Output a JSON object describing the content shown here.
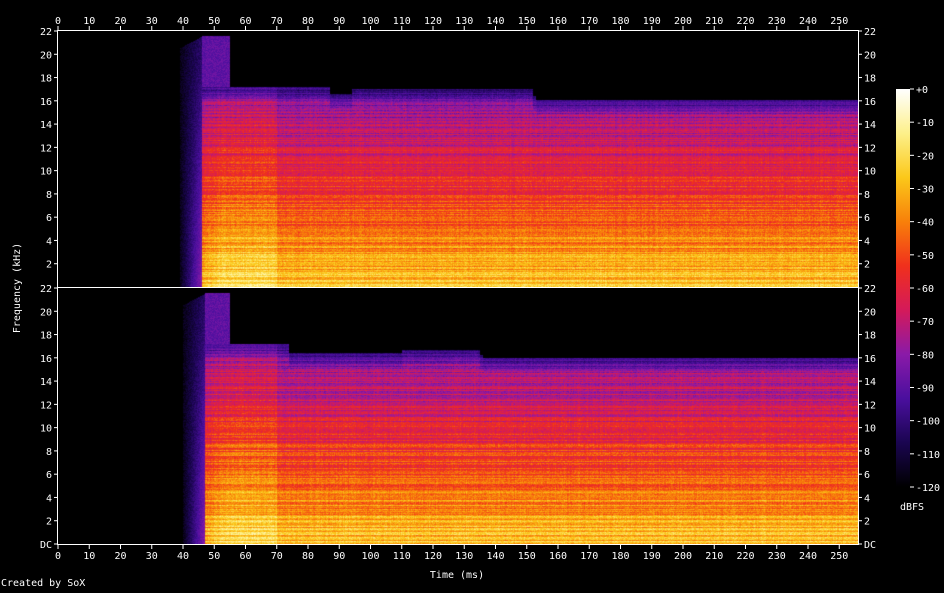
{
  "credit": "Created by SoX",
  "chart_data": {
    "type": "heatmap",
    "title": "",
    "xlabel": "Time (ms)",
    "ylabel": "Frequency (kHz)",
    "colorbar_label": "dBFS",
    "xlim": [
      0,
      256
    ],
    "ylim": [
      0,
      22
    ],
    "x_ticks": [
      0,
      10,
      20,
      30,
      40,
      50,
      60,
      70,
      80,
      90,
      100,
      110,
      120,
      130,
      140,
      150,
      160,
      170,
      180,
      190,
      200,
      210,
      220,
      230,
      240,
      250
    ],
    "y_ticks": [
      0,
      2,
      4,
      6,
      8,
      10,
      12,
      14,
      16,
      18,
      20,
      22
    ],
    "y_zero_label": "DC",
    "colorbar_ticks": [
      "+0",
      "-10",
      "-20",
      "-30",
      "-40",
      "-50",
      "-60",
      "-70",
      "-80",
      "-90",
      "-100",
      "-110",
      "-120"
    ],
    "colorbar_range": [
      -120,
      0
    ],
    "colormap": [
      "#000000",
      "#1a0550",
      "#4a0f9e",
      "#8a1aa8",
      "#d41a5a",
      "#f0301c",
      "#f8800a",
      "#fbc81a",
      "#fdf08a",
      "#ffffff"
    ],
    "channels": [
      {
        "onset_ms": 43,
        "shelf": [
          [
            55,
            17.2
          ],
          [
            87,
            17.2
          ],
          [
            88,
            16.6
          ],
          [
            94,
            16.6
          ],
          [
            95,
            17.0
          ],
          [
            152,
            17.0
          ],
          [
            153,
            16.4
          ],
          [
            257,
            16.1
          ]
        ]
      },
      {
        "onset_ms": 44,
        "shelf": [
          [
            55,
            17.2
          ],
          [
            74,
            17.2
          ],
          [
            75,
            16.4
          ],
          [
            110,
            16.4
          ],
          [
            111,
            16.7
          ],
          [
            135,
            16.7
          ],
          [
            136,
            16.2
          ],
          [
            257,
            16.0
          ]
        ]
      }
    ]
  }
}
